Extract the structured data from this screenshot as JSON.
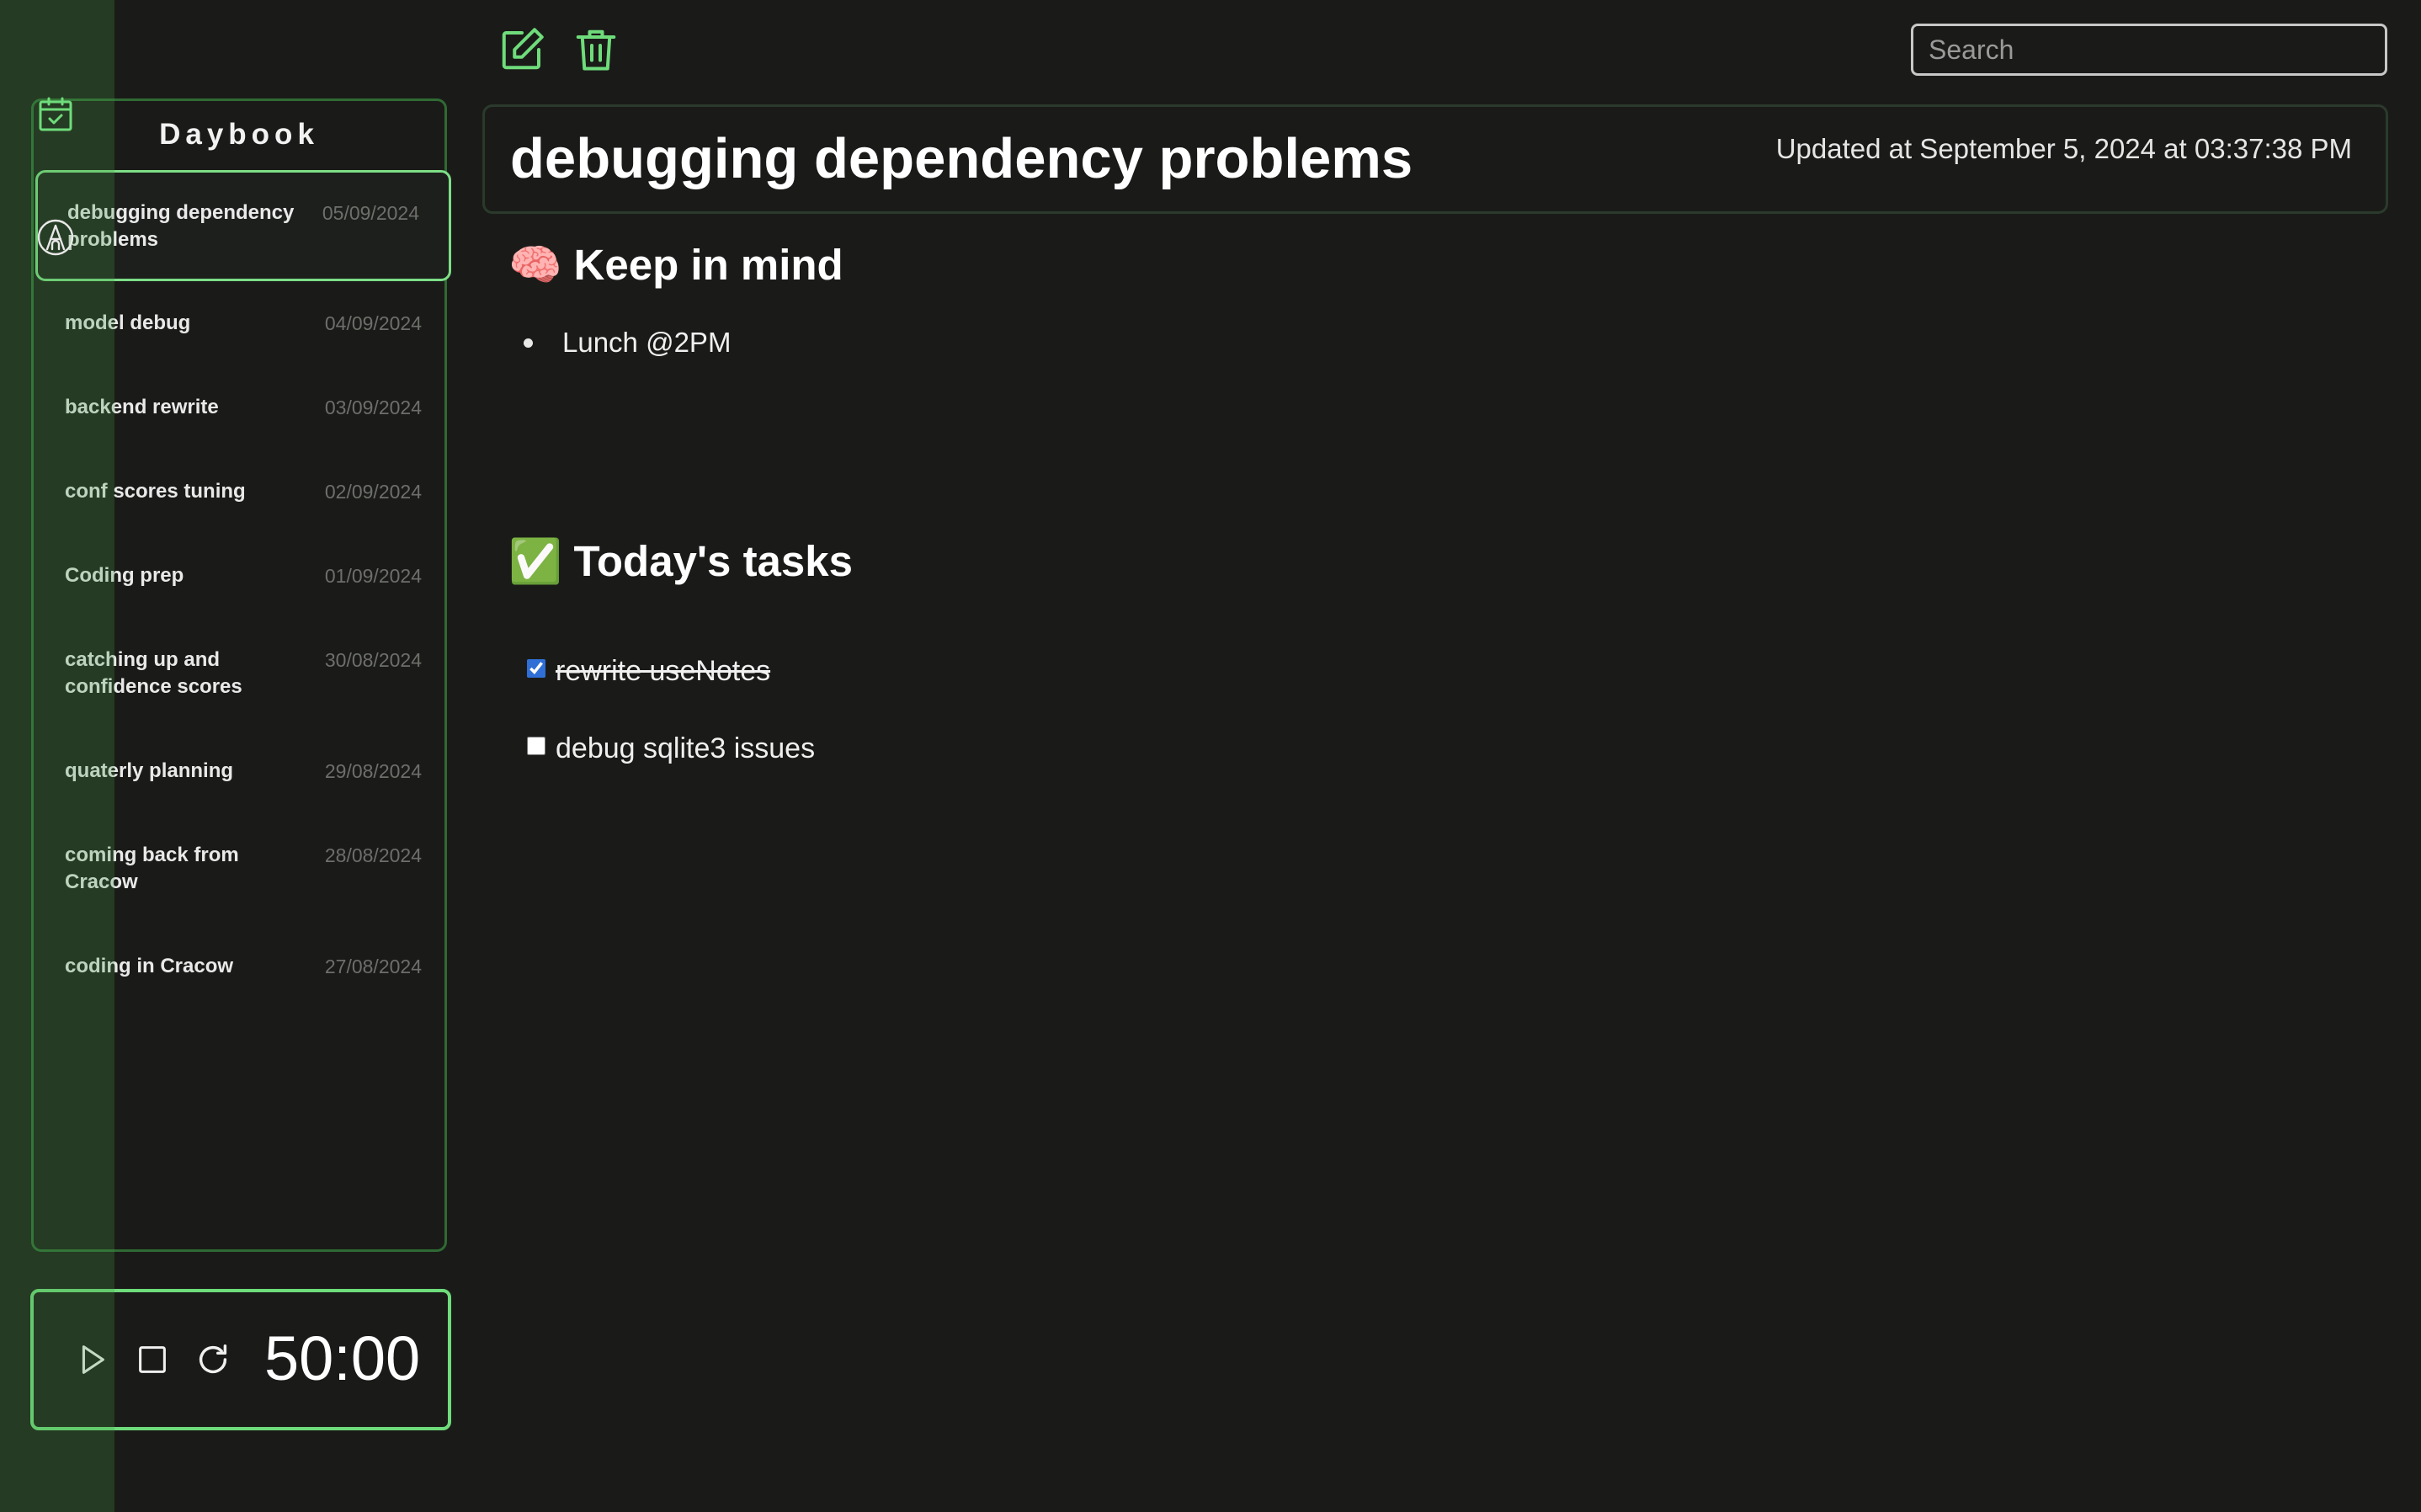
{
  "sidebar": {
    "title": "Daybook",
    "rail_icons": [
      "calendar-check-icon",
      "app-logo-icon"
    ],
    "notes": [
      {
        "title": "debugging dependency problems",
        "date": "05/09/2024",
        "selected": true
      },
      {
        "title": "model debug",
        "date": "04/09/2024",
        "selected": false
      },
      {
        "title": "backend rewrite",
        "date": "03/09/2024",
        "selected": false
      },
      {
        "title": "conf scores tuning",
        "date": "02/09/2024",
        "selected": false
      },
      {
        "title": "Coding prep",
        "date": "01/09/2024",
        "selected": false
      },
      {
        "title": "catching up and confidence scores",
        "date": "30/08/2024",
        "selected": false
      },
      {
        "title": "quaterly planning",
        "date": "29/08/2024",
        "selected": false
      },
      {
        "title": "coming back from Cracow",
        "date": "28/08/2024",
        "selected": false
      },
      {
        "title": "coding in Cracow",
        "date": "27/08/2024",
        "selected": false
      }
    ]
  },
  "timer": {
    "value": "50:00",
    "controls": [
      "play-icon",
      "stop-icon",
      "reset-icon"
    ]
  },
  "toolbar": {
    "edit_icon": "edit-icon",
    "delete_icon": "trash-icon",
    "search_placeholder": "Search",
    "search_value": ""
  },
  "note": {
    "title": "debugging dependency problems",
    "updated": "Updated at September 5, 2024 at 03:37:38 PM",
    "sections": [
      {
        "emoji": "🧠",
        "heading": "Keep in mind",
        "bullets": [
          "Lunch @2PM"
        ]
      },
      {
        "emoji": "✅",
        "heading": "Today's tasks",
        "tasks": [
          {
            "text": "rewrite useNotes",
            "done": true
          },
          {
            "text": "debug sqlite3 issues",
            "done": false
          }
        ]
      }
    ]
  },
  "colors": {
    "background": "#1a1b18",
    "accent": "#6fdc7b",
    "panel_border": "#2f6a34",
    "rail": "#3f6e3b"
  }
}
